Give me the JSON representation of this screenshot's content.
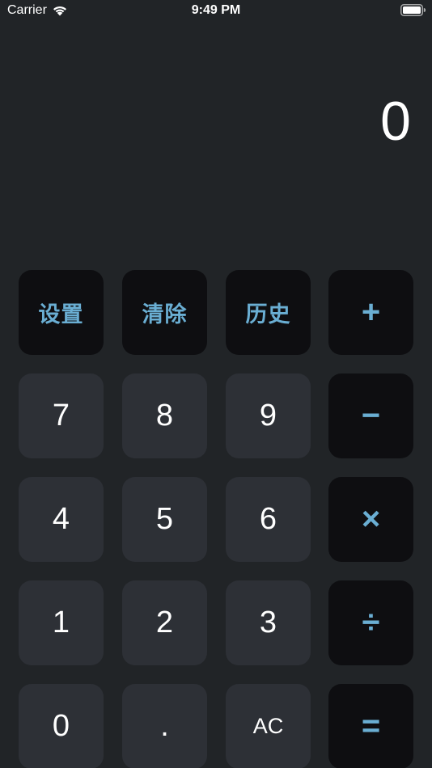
{
  "status_bar": {
    "carrier": "Carrier",
    "time": "9:49 PM",
    "wifi_icon": "wifi-icon",
    "battery_icon": "battery-icon"
  },
  "display": {
    "value": "0"
  },
  "keypad": {
    "row1": [
      "设置",
      "清除",
      "历史",
      "+"
    ],
    "row2": [
      "7",
      "8",
      "9",
      "−"
    ],
    "row3": [
      "4",
      "5",
      "6",
      "×"
    ],
    "row4": [
      "1",
      "2",
      "3",
      "÷"
    ],
    "row5": [
      "0",
      ".",
      "AC",
      "="
    ]
  },
  "colors": {
    "background": "#212427",
    "dark_key": "#0e0e11",
    "gray_key": "#2d3036",
    "accent": "#6aaed3",
    "text": "#ffffff"
  }
}
